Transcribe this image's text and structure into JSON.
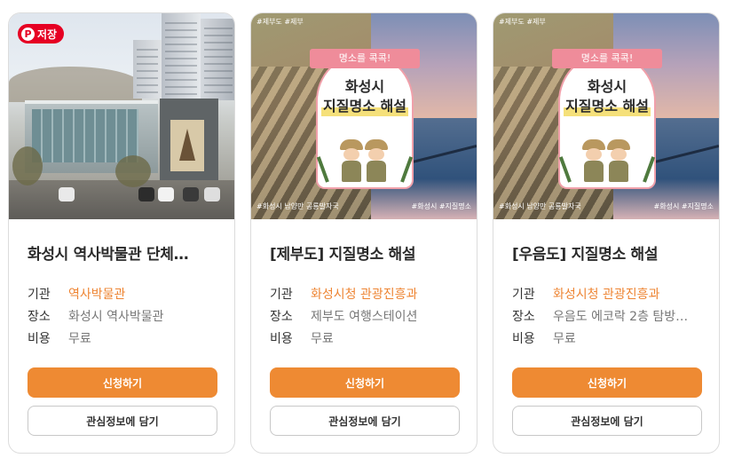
{
  "save_badge": {
    "pin_glyph": "P",
    "label": "저장",
    "color": "#e60023"
  },
  "accent_color": "#ee8a33",
  "cards": [
    {
      "title": "화성시 역사박물관 단체…",
      "meta": [
        {
          "key": "기관",
          "value": "역사박물관"
        },
        {
          "key": "장소",
          "value": "화성시 역사박물관"
        },
        {
          "key": "비용",
          "value": "무료"
        }
      ],
      "apply_label": "신청하기",
      "like_label": "관심정보에 담기"
    },
    {
      "title": "[제부도] 지질명소 해설",
      "poster": {
        "tag": "#제부도 #제부",
        "ribbon": "명소를 콕콕!",
        "line1": "화성시",
        "line2": "지질명소 해설",
        "caption_left": "#화성시 남양만 공룡발자국",
        "caption_right": "#화성시 #지질명소"
      },
      "meta": [
        {
          "key": "기관",
          "value": "화성시청 관광진흥과"
        },
        {
          "key": "장소",
          "value": "제부도 여행스테이션"
        },
        {
          "key": "비용",
          "value": "무료"
        }
      ],
      "apply_label": "신청하기",
      "like_label": "관심정보에 담기"
    },
    {
      "title": "[우음도] 지질명소 해설",
      "poster": {
        "tag": "#제부도 #제부",
        "ribbon": "명소를 콕콕!",
        "line1": "화성시",
        "line2": "지질명소 해설",
        "caption_left": "#화성시 남양만 공룡발자국",
        "caption_right": "#화성시 #지질명소"
      },
      "meta": [
        {
          "key": "기관",
          "value": "화성시청 관광진흥과"
        },
        {
          "key": "장소",
          "value": "우음도 에코락 2층 탐방…"
        },
        {
          "key": "비용",
          "value": "무료"
        }
      ],
      "apply_label": "신청하기",
      "like_label": "관심정보에 담기"
    }
  ]
}
